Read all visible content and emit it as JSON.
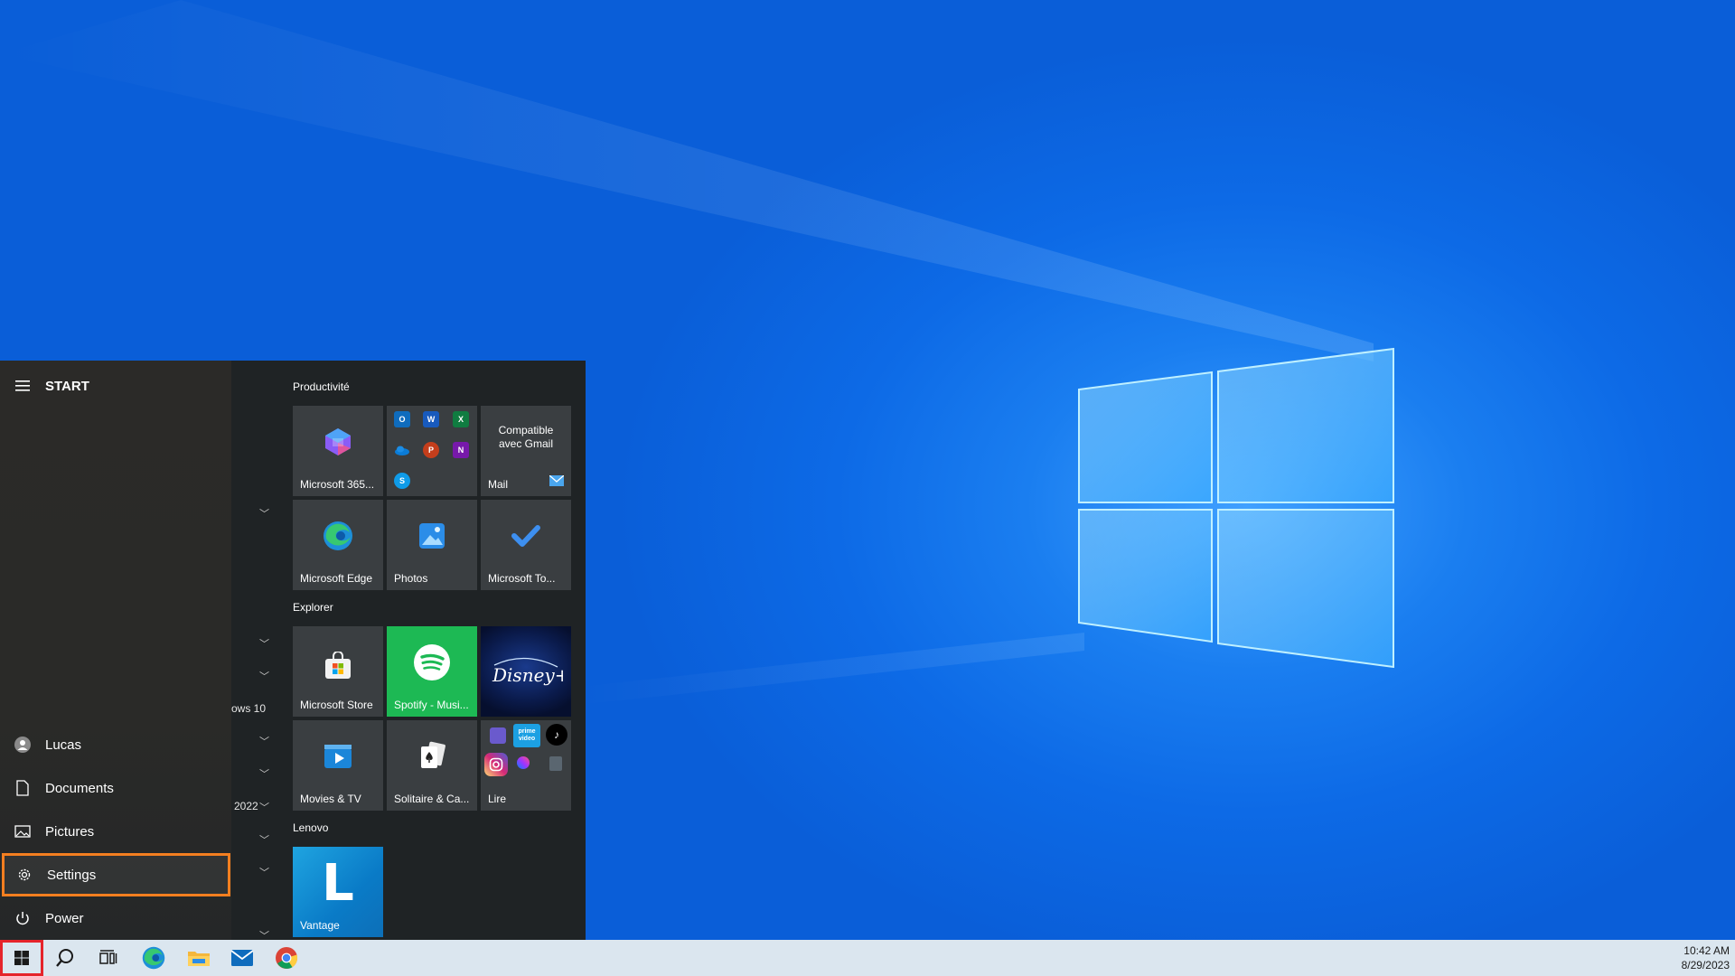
{
  "start_menu": {
    "title": "START",
    "rail": {
      "user": "Lucas",
      "documents": "Documents",
      "pictures": "Pictures",
      "settings": "Settings",
      "power": "Power"
    },
    "app_list_fragments": [
      "ows 10",
      "2022"
    ]
  },
  "groups": {
    "productivite": {
      "title": "Productivité",
      "tiles": {
        "m365": "Microsoft 365...",
        "mail_top": "Compatible avec Gmail",
        "mail": "Mail",
        "edge": "Microsoft Edge",
        "photos": "Photos",
        "todo": "Microsoft To..."
      }
    },
    "explorer": {
      "title": "Explorer",
      "tiles": {
        "store": "Microsoft Store",
        "spotify": "Spotify - Musi...",
        "movies": "Movies & TV",
        "solitaire": "Solitaire & Ca...",
        "lire": "Lire"
      }
    },
    "lenovo": {
      "title": "Lenovo",
      "tiles": {
        "vantage": "Vantage"
      }
    }
  },
  "tile_glyphs": {
    "outlook": "O",
    "word": "W",
    "excel": "X",
    "onedrive": "",
    "powerpoint": "P",
    "onenote": "N",
    "skype": "S",
    "vantage_letter": "L",
    "disney": "Disney+",
    "prime": "prime video"
  },
  "taskbar": {
    "icons": [
      "windows-start-icon",
      "search-icon",
      "task-view-icon",
      "edge-icon",
      "file-explorer-icon",
      "mail-icon",
      "chrome-icon"
    ],
    "time": "10:42 AM",
    "date": "8/29/2023"
  },
  "colors": {
    "accent_highlight": "#f47f20",
    "start_button_outline": "#e5242b",
    "spotify": "#1db954",
    "disney": "#0a1a4a"
  }
}
